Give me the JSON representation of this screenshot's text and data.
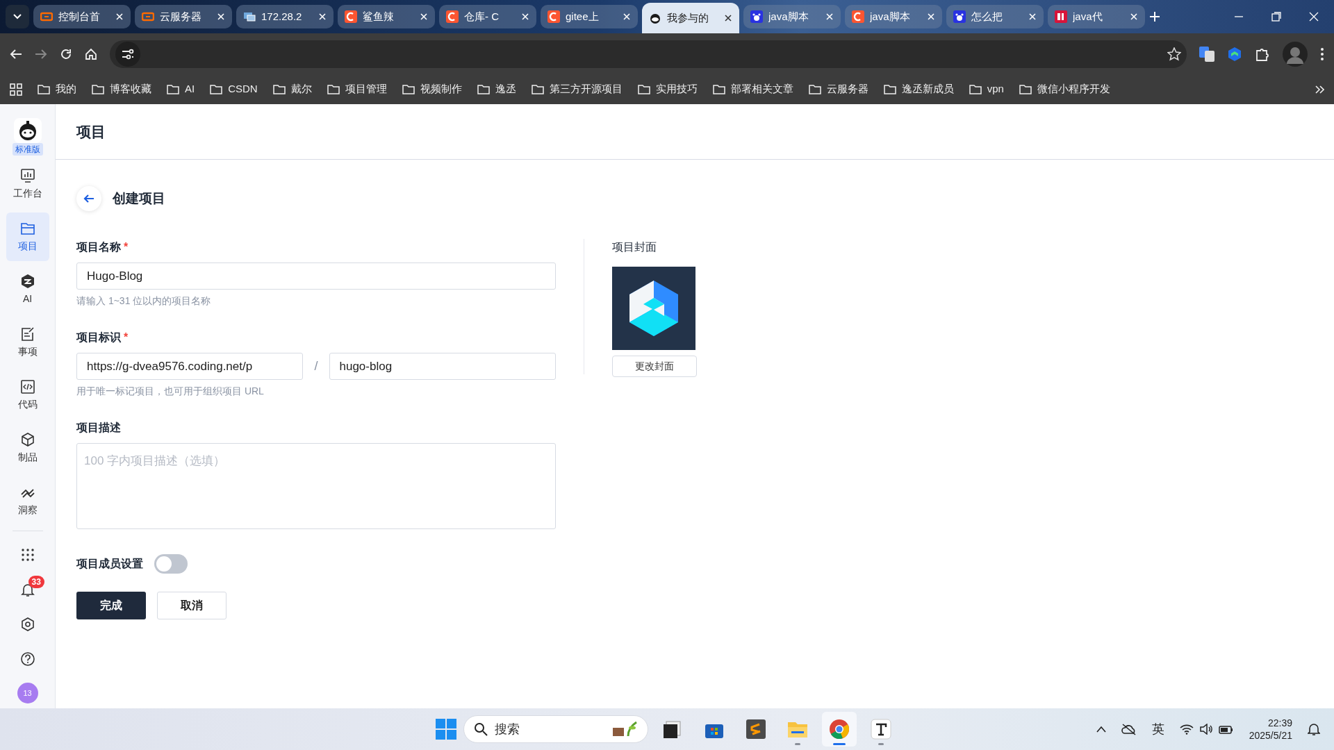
{
  "browser": {
    "tabs": [
      {
        "title": "控制台首",
        "kind": "aliyun",
        "selected": false
      },
      {
        "title": "云服务器",
        "kind": "aliyun",
        "selected": false
      },
      {
        "title": "172.28.2",
        "kind": "remote",
        "selected": false
      },
      {
        "title": "鲨鱼辣",
        "kind": "csdn",
        "selected": false
      },
      {
        "title": "仓库- C",
        "kind": "csdn",
        "selected": false
      },
      {
        "title": "gitee上",
        "kind": "csdn",
        "selected": false
      },
      {
        "title": "我参与的",
        "kind": "coding",
        "selected": true
      },
      {
        "title": "java脚本",
        "kind": "baidu",
        "selected": false
      },
      {
        "title": "java脚本",
        "kind": "csdn",
        "selected": false
      },
      {
        "title": "怎么把",
        "kind": "baidu",
        "selected": false
      },
      {
        "title": "java代",
        "kind": "cto",
        "selected": false
      }
    ],
    "forward_disabled": true,
    "bookmarks": [
      "我的",
      "博客收藏",
      "AI",
      "CSDN",
      "戴尔",
      "项目管理",
      "视频制作",
      "逸丞",
      "第三方开源项目",
      "实用技巧",
      "部署相关文章",
      "云服务器",
      "逸丞新成员",
      "vpn",
      "微信小程序开发"
    ]
  },
  "sidebar": {
    "edition": "标准版",
    "items": [
      {
        "label": "工作台",
        "kind": "dashboard",
        "selected": false
      },
      {
        "label": "项目",
        "kind": "folder",
        "selected": true
      },
      {
        "label": "AI",
        "kind": "ai",
        "selected": false
      },
      {
        "label": "事项",
        "kind": "task",
        "selected": false
      },
      {
        "label": "代码",
        "kind": "code",
        "selected": false
      },
      {
        "label": "制品",
        "kind": "cube",
        "selected": false
      },
      {
        "label": "洞察",
        "kind": "insight",
        "selected": false
      }
    ],
    "notification_count": "33",
    "avatar": "13"
  },
  "page": {
    "title": "项目",
    "subtitle": "创建项目",
    "name_field": {
      "label": "项目名称",
      "required_mark": "*",
      "value": "Hugo-Blog",
      "hint": "请输入 1~31 位以内的项目名称"
    },
    "id_field": {
      "label": "项目标识",
      "required_mark": "*",
      "prefix": "https://g-dvea9576.coding.net/p",
      "separator": "/",
      "value": "hugo-blog",
      "hint": "用于唯一标记项目，也可用于组织项目 URL"
    },
    "description": {
      "label": "项目描述",
      "placeholder": "100 字内项目描述（选填）"
    },
    "cover": {
      "label": "项目封面",
      "button": "更改封面"
    },
    "members": {
      "label": "项目成员设置",
      "on": false
    },
    "buttons": [
      {
        "label": "完成",
        "kind": "primary"
      },
      {
        "label": "取消",
        "kind": "secondary"
      }
    ]
  },
  "taskbar": {
    "search_placeholder": "搜索",
    "apps": [
      {
        "kind": "taskview",
        "open": false,
        "selected": false
      },
      {
        "kind": "store",
        "open": false,
        "selected": false
      },
      {
        "kind": "sublime",
        "open": false,
        "selected": false
      },
      {
        "kind": "explorer",
        "open": true,
        "selected": false
      },
      {
        "kind": "chrome",
        "open": true,
        "selected": true
      },
      {
        "kind": "typora",
        "open": true,
        "selected": false
      }
    ],
    "ime": "英",
    "time": "22:39",
    "date": "2025/5/21"
  }
}
